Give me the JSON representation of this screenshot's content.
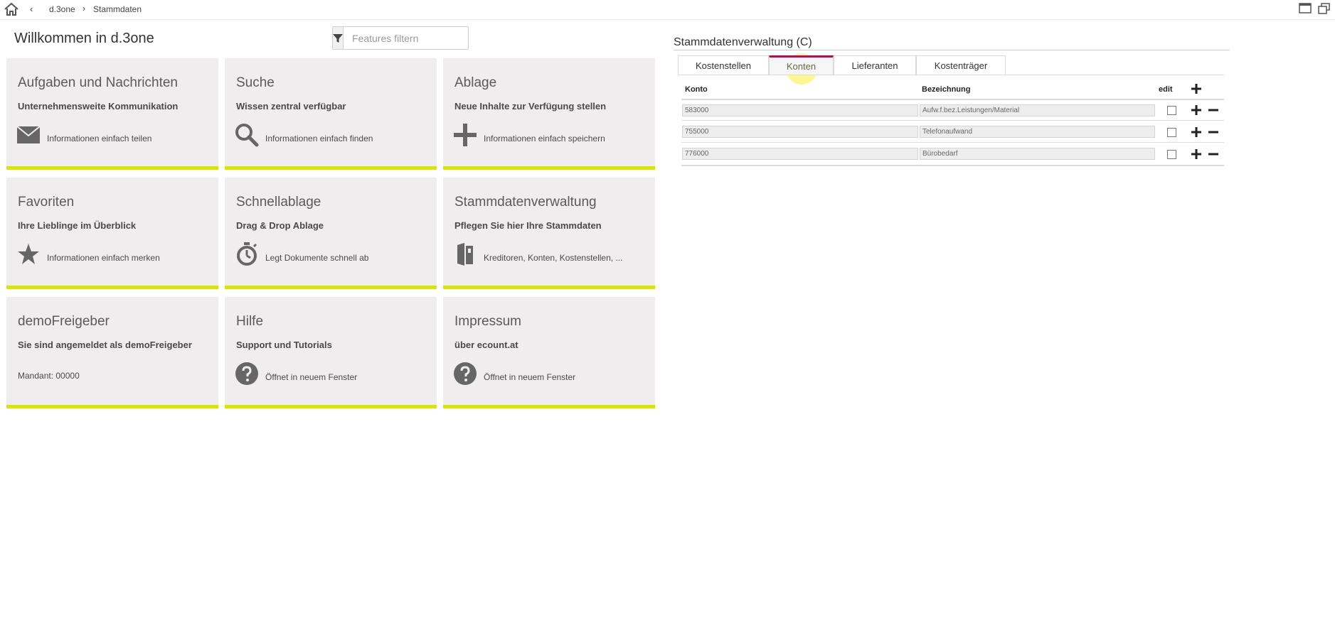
{
  "breadcrumb": {
    "back": "‹",
    "items": [
      "d.3one",
      "Stammdaten"
    ],
    "separator": "›"
  },
  "welcome_title": "Willkommen in d.3one",
  "filter": {
    "placeholder": "Features filtern",
    "value": ""
  },
  "tiles": [
    {
      "title": "Aufgaben und Nachrichten",
      "subtitle": "Unternehmensweite Kommunikation",
      "icon": "envelope-icon",
      "description": "Informationen einfach teilen"
    },
    {
      "title": "Suche",
      "subtitle": "Wissen zentral verfügbar",
      "icon": "search-icon",
      "description": "Informationen einfach finden"
    },
    {
      "title": "Ablage",
      "subtitle": "Neue Inhalte zur Verfügung stellen",
      "icon": "plus-icon",
      "description": "Informationen einfach speichern"
    },
    {
      "title": "Favoriten",
      "subtitle": "Ihre Lieblinge im Überblick",
      "icon": "star-icon",
      "description": "Informationen einfach merken"
    },
    {
      "title": "Schnellablage",
      "subtitle": "Drag & Drop Ablage",
      "icon": "stopwatch-icon",
      "description": "Legt Dokumente schnell ab"
    },
    {
      "title": "Stammdatenverwaltung",
      "subtitle": "Pflegen Sie hier Ihre Stammdaten",
      "icon": "binder-icon",
      "description": "Kreditoren, Konten, Kostenstellen, ..."
    },
    {
      "title": "demoFreigeber",
      "subtitle": "Sie sind angemeldet als demoFreigeber",
      "icon": "",
      "description": "Mandant: 00000"
    },
    {
      "title": "Hilfe",
      "subtitle": "Support und Tutorials",
      "icon": "help-icon",
      "description": "Öffnet in neuem Fenster"
    },
    {
      "title": "Impressum",
      "subtitle": "über ecount.at",
      "icon": "help-icon",
      "description": "Öffnet in neuem Fenster"
    }
  ],
  "accent_colors": {
    "tile_border": "#d5e021",
    "active_tab": "#a3174e",
    "tile_bg": "#efedee"
  },
  "panel": {
    "title": "Stammdatenverwaltung (C)",
    "tabs": [
      "Kostenstellen",
      "Konten",
      "Lieferanten",
      "Kostenträger"
    ],
    "active_tab": "Konten",
    "columns": {
      "konto": "Konto",
      "bezeichnung": "Bezeichnung",
      "edit": "edit"
    },
    "rows": [
      {
        "konto": "583000",
        "bezeichnung": "Aufw.f.bez.Leistungen/Material",
        "edit": false
      },
      {
        "konto": "755000",
        "bezeichnung": "Telefonaufwand",
        "edit": false
      },
      {
        "konto": "776000",
        "bezeichnung": "Bürobedarf",
        "edit": false
      }
    ]
  }
}
